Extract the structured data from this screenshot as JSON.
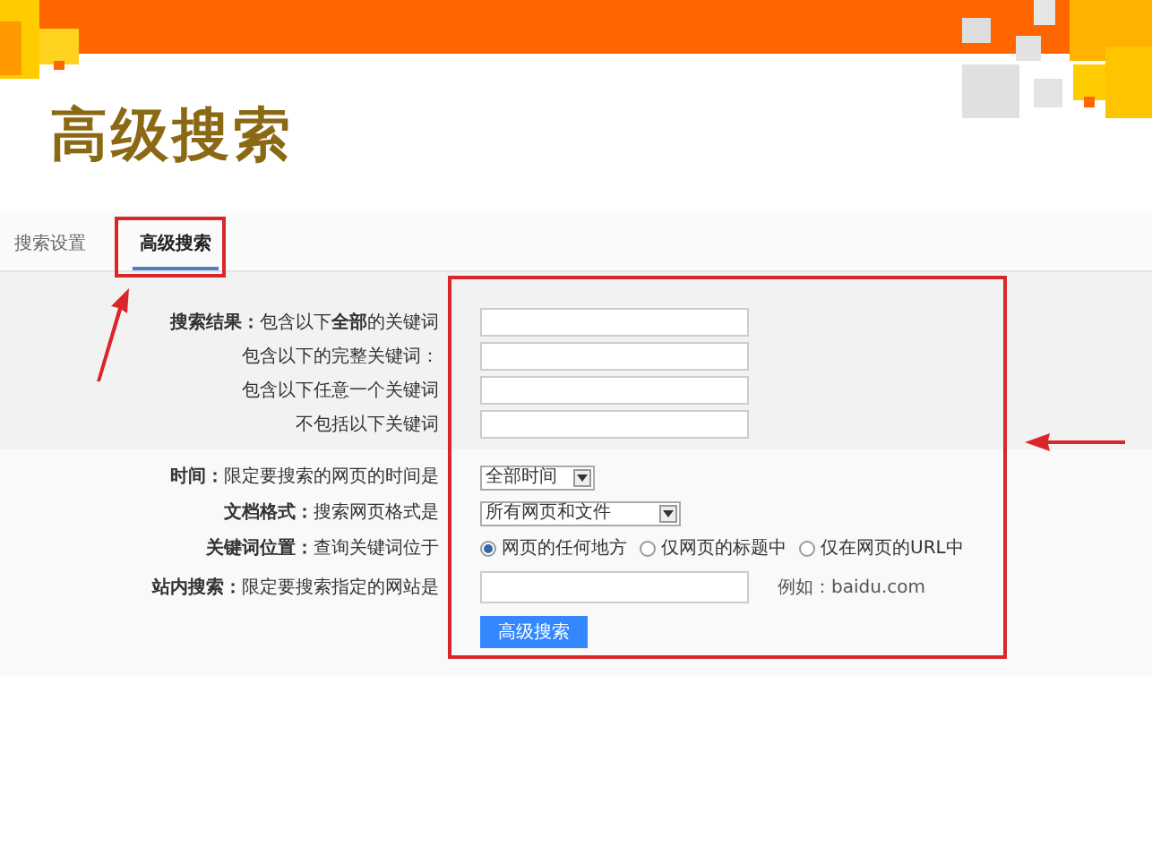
{
  "slide_title": "高级搜索",
  "tabs": [
    {
      "label": "搜索设置",
      "selected": false
    },
    {
      "label": "高级搜索",
      "selected": true
    }
  ],
  "keyword_rows": [
    {
      "section": "搜索结果：",
      "label": "包含以下**全部**的关键词"
    },
    {
      "label": "包含以下的完整关键词："
    },
    {
      "label": "包含以下任意一个关键词"
    },
    {
      "label": "不包括以下关键词"
    }
  ],
  "option_rows": [
    {
      "kind": "select",
      "section": "时间：",
      "label": "限定要搜索的网页的时间是",
      "value": "全部时间",
      "wide": false
    },
    {
      "kind": "select",
      "section": "文档格式：",
      "label": "搜索网页格式是",
      "value": "所有网页和文件",
      "wide": true
    },
    {
      "kind": "radio",
      "section": "关键词位置：",
      "label": "查询关键词位于",
      "options": [
        {
          "label": "网页的任何地方",
          "selected": true
        },
        {
          "label": "仅网页的标题中",
          "selected": false
        },
        {
          "label": "仅在网页的URL中",
          "selected": false
        }
      ]
    },
    {
      "kind": "site",
      "section": "站内搜索：",
      "label": "限定要搜索指定的网站是",
      "hint": "例如：baidu.com"
    }
  ],
  "submit_button": "高级搜索"
}
